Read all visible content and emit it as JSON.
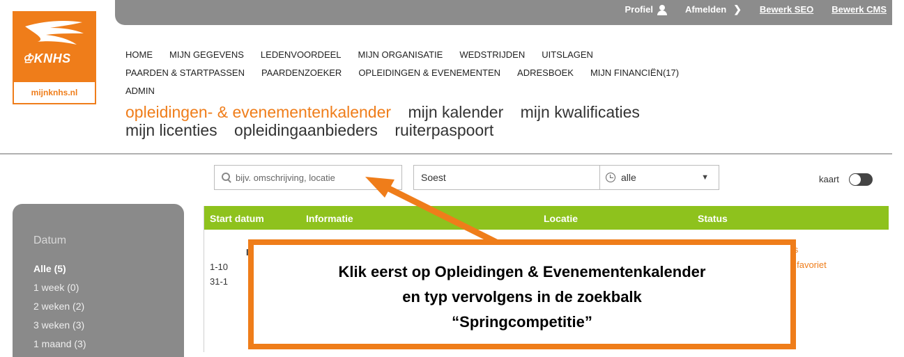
{
  "topbar": {
    "profiel": "Profiel",
    "afmelden": "Afmelden",
    "seo": "Bewerk SEO",
    "cms": "Bewerk CMS"
  },
  "logo": {
    "brand": "KNHS",
    "site": "mijnknhs.nl"
  },
  "nav": {
    "row1": [
      "HOME",
      "MIJN GEGEVENS",
      "LEDENVOORDEEL",
      "MIJN ORGANISATIE",
      "WEDSTRIJDEN",
      "UITSLAGEN"
    ],
    "row2": [
      "PAARDEN & STARTPASSEN",
      "PAARDENZOEKER",
      "OPLEIDINGEN & EVENEMENTEN",
      "ADRESBOEK",
      "MIJN FINANCIËN(17)"
    ],
    "row3": [
      "ADMIN"
    ]
  },
  "subnav": {
    "active": "opleidingen- & evenementenkalender",
    "calendar": "mijn kalender",
    "qualifications": "mijn kwalificaties",
    "licenses": "mijn licenties",
    "providers": "opleidingaanbieders",
    "passport": "ruiterpaspoort"
  },
  "search": {
    "placeholder": "bijv. omschrijving, locatie",
    "location": "Soest",
    "period": "alle",
    "map_label": "kaart"
  },
  "sidebar": {
    "heading": "Datum",
    "items": [
      "Alle (5)",
      "1 week (0)",
      "2 weken (2)",
      "3 weken (3)",
      "1 maand (3)"
    ]
  },
  "table": {
    "headers": [
      "Start datum",
      "Informatie",
      "Locatie",
      "Status"
    ],
    "rows": [
      "I",
      "1-10",
      "31-1"
    ],
    "actions": [
      "ils",
      "k favoriet"
    ]
  },
  "callout": {
    "line1": "Klik eerst op Opleidingen & Evenementenkalender",
    "line2": "en typ vervolgens in de zoekbalk",
    "line3": "“Springcompetitie”"
  },
  "colors": {
    "accent": "#ef7d1a",
    "header_green": "#8ec21d",
    "topbar": "#8c8c8c"
  }
}
